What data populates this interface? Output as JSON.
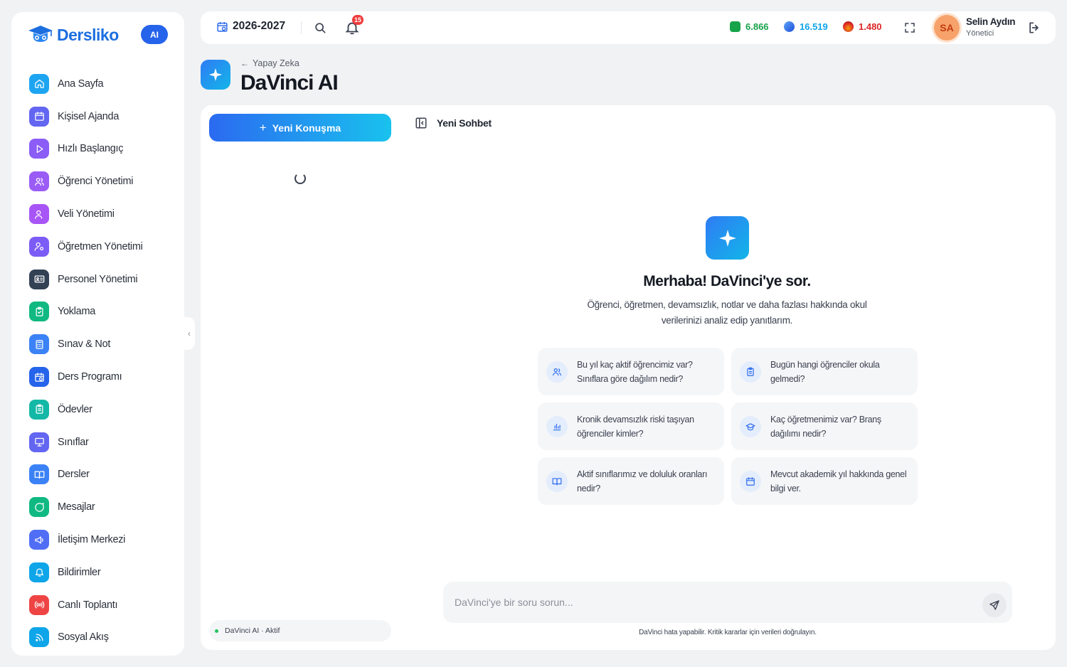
{
  "brand": {
    "name": "Dersliko",
    "ai_badge": "AI"
  },
  "sidebar": {
    "items": [
      {
        "label": "Ana Sayfa",
        "icon": "home-icon",
        "color": "#1ea5f2"
      },
      {
        "label": "Kişisel Ajanda",
        "icon": "calendar-icon",
        "color": "#6366f1"
      },
      {
        "label": "Hızlı Başlangıç",
        "icon": "play-icon",
        "color": "#8b5cf6"
      },
      {
        "label": "Öğrenci Yönetimi",
        "icon": "users-icon",
        "color": "#9b5cf6"
      },
      {
        "label": "Veli Yönetimi",
        "icon": "user-heart-icon",
        "color": "#a855f7"
      },
      {
        "label": "Öğretmen Yönetimi",
        "icon": "user-gear-icon",
        "color": "#7c5cf6"
      },
      {
        "label": "Personel Yönetimi",
        "icon": "id-card-icon",
        "color": "#334155"
      },
      {
        "label": "Yoklama",
        "icon": "clipboard-check-icon",
        "color": "#10b981"
      },
      {
        "label": "Sınav & Not",
        "icon": "calculator-icon",
        "color": "#3b82f6"
      },
      {
        "label": "Ders Programı",
        "icon": "calendar-clock-icon",
        "color": "#2563eb"
      },
      {
        "label": "Ödevler",
        "icon": "clipboard-icon",
        "color": "#14b8a6"
      },
      {
        "label": "Sınıflar",
        "icon": "presentation-icon",
        "color": "#6366f1"
      },
      {
        "label": "Dersler",
        "icon": "book-open-icon",
        "color": "#3b82f6"
      },
      {
        "label": "Mesajlar",
        "icon": "message-circle-icon",
        "color": "#10b981"
      },
      {
        "label": "İletişim Merkezi",
        "icon": "megaphone-icon",
        "color": "#4f6ef5"
      },
      {
        "label": "Bildirimler",
        "icon": "bell-icon",
        "color": "#0ea5e9"
      },
      {
        "label": "Canlı Toplantı",
        "icon": "broadcast-icon",
        "color": "#ef4444"
      },
      {
        "label": "Sosyal Akış",
        "icon": "rss-icon",
        "color": "#0ea5e9"
      }
    ]
  },
  "topbar": {
    "year": "2026-2027",
    "notification_count": "15",
    "coins": [
      {
        "value": "6.866",
        "color": "#16a34a",
        "icon": "green-gem-icon"
      },
      {
        "value": "16.519",
        "color": "#0ea5e9",
        "icon": "blue-gem-icon"
      },
      {
        "value": "1.480",
        "color": "#dc2626",
        "icon": "fire-icon"
      }
    ],
    "user": {
      "initials": "SA",
      "name": "Selin Aydın",
      "role": "Yönetici"
    }
  },
  "page": {
    "breadcrumb": "Yapay Zeka",
    "title": "DaVinci AI"
  },
  "chat": {
    "new_button": "Yeni Konuşma",
    "current_title": "Yeni Sohbet",
    "status": "DaVinci AI · Aktif",
    "hero_title": "Merhaba! DaVinci'ye sor.",
    "hero_subtitle": "Öğrenci, öğretmen, devamsızlık, notlar ve daha fazlası hakkında okul verilerinizi analiz edip yanıtlarım.",
    "suggestions": [
      {
        "text": "Bu yıl kaç aktif öğrencimiz var? Sınıflara göre dağılım nedir?",
        "icon": "users-icon"
      },
      {
        "text": "Bugün hangi öğrenciler okula gelmedi?",
        "icon": "clipboard-icon"
      },
      {
        "text": "Kronik devamsızlık riski taşıyan öğrenciler kimler?",
        "icon": "bar-chart-icon"
      },
      {
        "text": "Kaç öğretmenimiz var? Branş dağılımı nedir?",
        "icon": "graduation-cap-icon"
      },
      {
        "text": "Aktif sınıflarımız ve doluluk oranları nedir?",
        "icon": "book-open-icon"
      },
      {
        "text": "Mevcut akademik yıl hakkında genel bilgi ver.",
        "icon": "calendar-icon"
      }
    ],
    "input_placeholder": "DaVinci'ye bir soru sorun...",
    "disclaimer": "DaVinci hata yapabilir. Kritik kararlar için verileri doğrulayın."
  }
}
